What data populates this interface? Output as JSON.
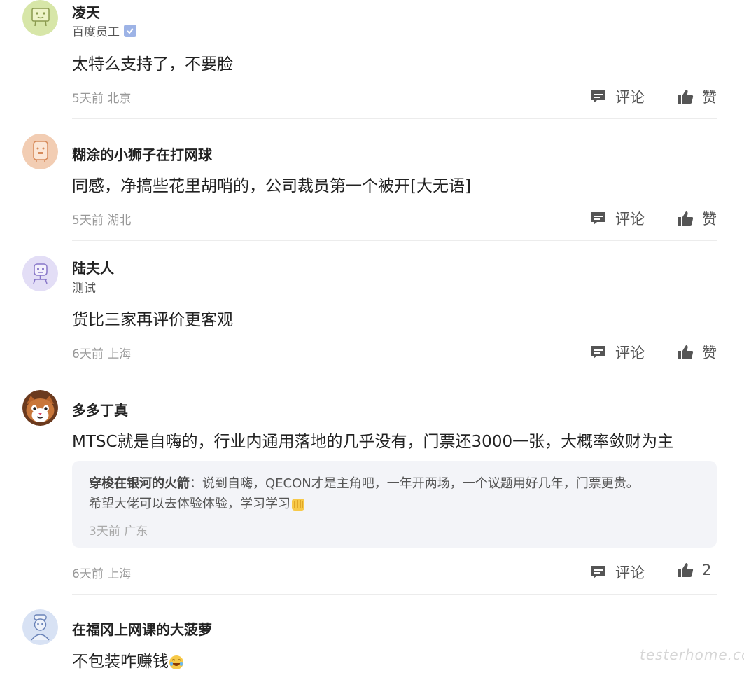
{
  "comments": [
    {
      "name": "凌天",
      "subtitle": "百度员工",
      "verified": true,
      "text": "太特么支持了，不要脸",
      "meta": "5天前 北京",
      "comment_label": "评论",
      "like_label": "赞",
      "avatar_icon": "cheese-icon",
      "avatar_color": "#d7e6a8"
    },
    {
      "name": "糊涂的小狮子在打网球",
      "text": "同感，净搞些花里胡哨的，公司裁员第一个被开[大无语]",
      "meta": "5天前 湖北",
      "comment_label": "评论",
      "like_label": "赞",
      "avatar_icon": "toast-icon",
      "avatar_color": "#f2cdb3"
    },
    {
      "name": "陆夫人",
      "subtitle": "测试",
      "text": "货比三家再评价更客观",
      "meta": "6天前 上海",
      "comment_label": "评论",
      "like_label": "赞",
      "avatar_icon": "robot-icon",
      "avatar_color": "#e3def6"
    },
    {
      "name": "多多丁真",
      "text": "MTSC就是自嗨的，行业内通用落地的几乎没有，门票还3000一张，大概率敛财为主",
      "meta": "6天前 上海",
      "comment_label": "评论",
      "like_label": "2",
      "avatar_icon": "cat-icon",
      "reply": {
        "author": "穿梭在银河的火箭",
        "line1": "：说到自嗨，QECON才是主角吧，一年开两场，一个议题用好几年，门票更贵。",
        "line2": "希望大佬可以去体验体验，学习学习",
        "meta": "3天前 广东"
      }
    },
    {
      "name": "在福冈上网课的大菠萝",
      "text": "不包装咋赚钱",
      "avatar_icon": "person-icon",
      "avatar_color": "#d8e2f4"
    }
  ],
  "watermark": "testerhome.com"
}
